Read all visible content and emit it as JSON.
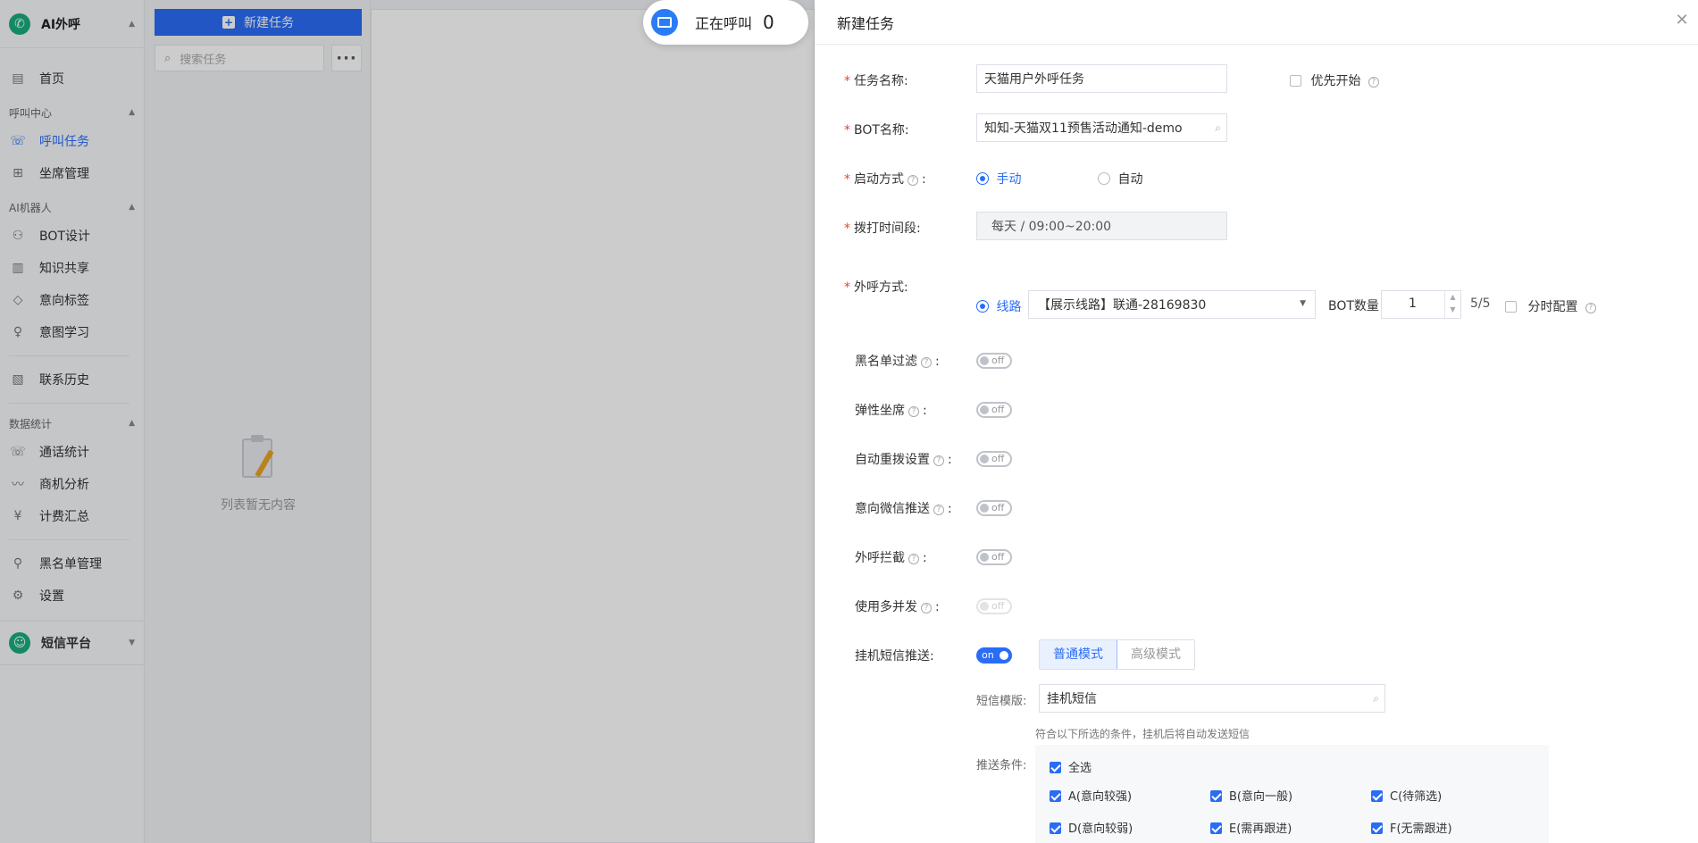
{
  "sidebar": {
    "app_title": "AI外呼",
    "home": "首页",
    "group_call_center": "呼叫中心",
    "call_tasks": "呼叫任务",
    "agent_mgmt": "坐席管理",
    "group_ai_robot": "AI机器人",
    "bot_design": "BOT设计",
    "knowledge_share": "知识共享",
    "intent_tags": "意向标签",
    "intent_learning": "意图学习",
    "contact_history": "联系历史",
    "group_data_stats": "数据统计",
    "call_stats": "通话统计",
    "biz_analysis": "商机分析",
    "billing_summary": "计费汇总",
    "blacklist_mgmt": "黑名单管理",
    "settings": "设置",
    "sms_platform": "短信平台"
  },
  "tasklist": {
    "new_task_label": "新建任务",
    "search_placeholder": "搜索任务",
    "empty_text": "列表暂无内容"
  },
  "calling": {
    "label": "正在呼叫",
    "count": "0"
  },
  "drawer": {
    "title": "新建任务",
    "task_name_label": "任务名称:",
    "task_name_value": "天猫用户外呼任务",
    "priority_label": "优先开始",
    "bot_name_label": "BOT名称:",
    "bot_name_value": "知知-天猫双11预售活动通知-demo",
    "start_mode_label": "启动方式",
    "start_manual": "手动",
    "start_auto": "自动",
    "dial_period_label": "拨打时间段:",
    "dial_period_value": "每天 / 09:00~20:00",
    "call_method_label": "外呼方式:",
    "line_label": "线路",
    "line_value": "【展示线路】联通-28169830",
    "bot_count_label": "BOT数量",
    "bot_count_value": "1",
    "bot_count_ratio": "5/5",
    "time_config_label": "分时配置",
    "blacklist_filter_label": "黑名单过滤",
    "elastic_agent_label": "弹性坐席",
    "auto_redial_label": "自动重拨设置",
    "wechat_push_label": "意向微信推送",
    "call_intercept_label": "外呼拦截",
    "multi_concurrency_label": "使用多并发",
    "hangup_sms_label": "挂机短信推送:",
    "toggle_off": "off",
    "toggle_on": "on",
    "mode_normal": "普通模式",
    "mode_advanced": "高级模式",
    "sms_template_label": "短信模版:",
    "sms_template_value": "挂机短信",
    "sms_hint": "符合以下所选的条件，挂机后将自动发送短信",
    "push_condition_label": "推送条件:",
    "select_all": "全选",
    "cond_a": "A(意向较强)",
    "cond_b": "B(意向一般)",
    "cond_c": "C(待筛选)",
    "cond_d": "D(意向较弱)",
    "cond_e": "E(需再跟进)",
    "cond_f": "F(无需跟进)"
  },
  "colors": {
    "primary": "#2a6cf6",
    "required": "#e5452f",
    "logo": "#1aad7d"
  }
}
